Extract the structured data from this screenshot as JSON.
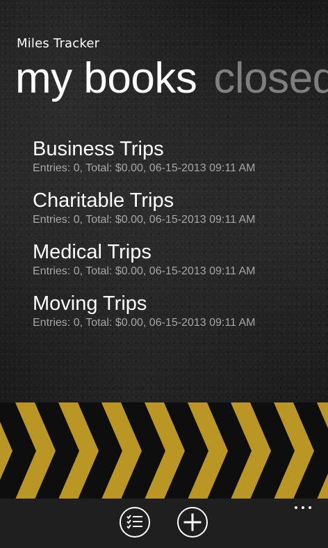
{
  "app": {
    "title": "Miles Tracker"
  },
  "pivot": {
    "headers": [
      "my books",
      "closed"
    ]
  },
  "books": [
    {
      "name": "Business Trips",
      "meta": "Entries: 0, Total: $0.00, 06-15-2013 09:11 AM"
    },
    {
      "name": "Charitable Trips",
      "meta": "Entries: 0, Total: $0.00, 06-15-2013 09:11 AM"
    },
    {
      "name": "Medical Trips",
      "meta": "Entries: 0, Total: $0.00, 06-15-2013 09:11 AM"
    },
    {
      "name": "Moving Trips",
      "meta": "Entries: 0, Total: $0.00, 06-15-2013 09:11 AM"
    }
  ],
  "app_bar": {
    "buttons": [
      {
        "icon": "checklist-icon"
      },
      {
        "icon": "add-icon"
      }
    ],
    "more_icon": "ellipsis-icon"
  },
  "colors": {
    "background": "#1e1e1e",
    "chevron": "#c9a227",
    "app_bar": "#1f1f1f",
    "subtle_text": "#a6a6a6"
  }
}
